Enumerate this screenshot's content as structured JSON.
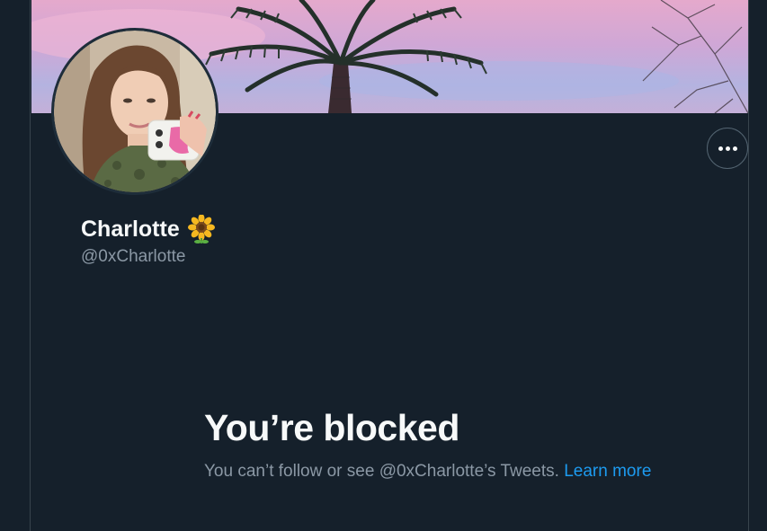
{
  "profile": {
    "display_name": "Charlotte",
    "handle": "@0xCharlotte",
    "name_emoji_icon": "sunflower-icon",
    "avatar_icon": "profile-photo",
    "more_icon": "more-horizontal-icon"
  },
  "blocked": {
    "title": "You’re blocked",
    "message": "You can’t follow or see @0xCharlotte’s Tweets.",
    "link_label": "Learn more"
  },
  "colors": {
    "background": "#15202b",
    "primary_text": "#f7f9f9",
    "secondary_text": "#8b98a5",
    "link": "#1d9bf0",
    "border": "#38444d"
  }
}
